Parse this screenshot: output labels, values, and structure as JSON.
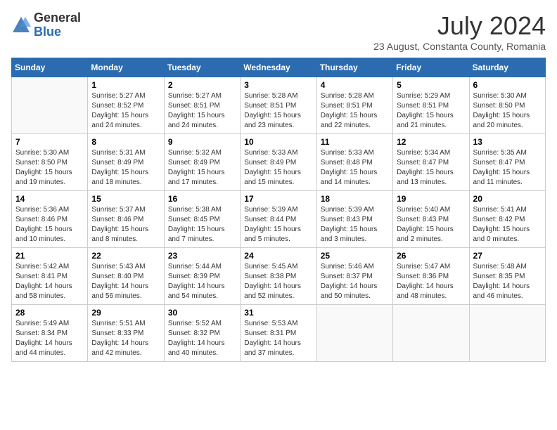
{
  "logo": {
    "general": "General",
    "blue": "Blue"
  },
  "title": "July 2024",
  "subtitle": "23 August, Constanta County, Romania",
  "days_of_week": [
    "Sunday",
    "Monday",
    "Tuesday",
    "Wednesday",
    "Thursday",
    "Friday",
    "Saturday"
  ],
  "weeks": [
    [
      {
        "day": "",
        "info": ""
      },
      {
        "day": "1",
        "info": "Sunrise: 5:27 AM\nSunset: 8:52 PM\nDaylight: 15 hours\nand 24 minutes."
      },
      {
        "day": "2",
        "info": "Sunrise: 5:27 AM\nSunset: 8:51 PM\nDaylight: 15 hours\nand 24 minutes."
      },
      {
        "day": "3",
        "info": "Sunrise: 5:28 AM\nSunset: 8:51 PM\nDaylight: 15 hours\nand 23 minutes."
      },
      {
        "day": "4",
        "info": "Sunrise: 5:28 AM\nSunset: 8:51 PM\nDaylight: 15 hours\nand 22 minutes."
      },
      {
        "day": "5",
        "info": "Sunrise: 5:29 AM\nSunset: 8:51 PM\nDaylight: 15 hours\nand 21 minutes."
      },
      {
        "day": "6",
        "info": "Sunrise: 5:30 AM\nSunset: 8:50 PM\nDaylight: 15 hours\nand 20 minutes."
      }
    ],
    [
      {
        "day": "7",
        "info": "Sunrise: 5:30 AM\nSunset: 8:50 PM\nDaylight: 15 hours\nand 19 minutes."
      },
      {
        "day": "8",
        "info": "Sunrise: 5:31 AM\nSunset: 8:49 PM\nDaylight: 15 hours\nand 18 minutes."
      },
      {
        "day": "9",
        "info": "Sunrise: 5:32 AM\nSunset: 8:49 PM\nDaylight: 15 hours\nand 17 minutes."
      },
      {
        "day": "10",
        "info": "Sunrise: 5:33 AM\nSunset: 8:49 PM\nDaylight: 15 hours\nand 15 minutes."
      },
      {
        "day": "11",
        "info": "Sunrise: 5:33 AM\nSunset: 8:48 PM\nDaylight: 15 hours\nand 14 minutes."
      },
      {
        "day": "12",
        "info": "Sunrise: 5:34 AM\nSunset: 8:47 PM\nDaylight: 15 hours\nand 13 minutes."
      },
      {
        "day": "13",
        "info": "Sunrise: 5:35 AM\nSunset: 8:47 PM\nDaylight: 15 hours\nand 11 minutes."
      }
    ],
    [
      {
        "day": "14",
        "info": "Sunrise: 5:36 AM\nSunset: 8:46 PM\nDaylight: 15 hours\nand 10 minutes."
      },
      {
        "day": "15",
        "info": "Sunrise: 5:37 AM\nSunset: 8:46 PM\nDaylight: 15 hours\nand 8 minutes."
      },
      {
        "day": "16",
        "info": "Sunrise: 5:38 AM\nSunset: 8:45 PM\nDaylight: 15 hours\nand 7 minutes."
      },
      {
        "day": "17",
        "info": "Sunrise: 5:39 AM\nSunset: 8:44 PM\nDaylight: 15 hours\nand 5 minutes."
      },
      {
        "day": "18",
        "info": "Sunrise: 5:39 AM\nSunset: 8:43 PM\nDaylight: 15 hours\nand 3 minutes."
      },
      {
        "day": "19",
        "info": "Sunrise: 5:40 AM\nSunset: 8:43 PM\nDaylight: 15 hours\nand 2 minutes."
      },
      {
        "day": "20",
        "info": "Sunrise: 5:41 AM\nSunset: 8:42 PM\nDaylight: 15 hours\nand 0 minutes."
      }
    ],
    [
      {
        "day": "21",
        "info": "Sunrise: 5:42 AM\nSunset: 8:41 PM\nDaylight: 14 hours\nand 58 minutes."
      },
      {
        "day": "22",
        "info": "Sunrise: 5:43 AM\nSunset: 8:40 PM\nDaylight: 14 hours\nand 56 minutes."
      },
      {
        "day": "23",
        "info": "Sunrise: 5:44 AM\nSunset: 8:39 PM\nDaylight: 14 hours\nand 54 minutes."
      },
      {
        "day": "24",
        "info": "Sunrise: 5:45 AM\nSunset: 8:38 PM\nDaylight: 14 hours\nand 52 minutes."
      },
      {
        "day": "25",
        "info": "Sunrise: 5:46 AM\nSunset: 8:37 PM\nDaylight: 14 hours\nand 50 minutes."
      },
      {
        "day": "26",
        "info": "Sunrise: 5:47 AM\nSunset: 8:36 PM\nDaylight: 14 hours\nand 48 minutes."
      },
      {
        "day": "27",
        "info": "Sunrise: 5:48 AM\nSunset: 8:35 PM\nDaylight: 14 hours\nand 46 minutes."
      }
    ],
    [
      {
        "day": "28",
        "info": "Sunrise: 5:49 AM\nSunset: 8:34 PM\nDaylight: 14 hours\nand 44 minutes."
      },
      {
        "day": "29",
        "info": "Sunrise: 5:51 AM\nSunset: 8:33 PM\nDaylight: 14 hours\nand 42 minutes."
      },
      {
        "day": "30",
        "info": "Sunrise: 5:52 AM\nSunset: 8:32 PM\nDaylight: 14 hours\nand 40 minutes."
      },
      {
        "day": "31",
        "info": "Sunrise: 5:53 AM\nSunset: 8:31 PM\nDaylight: 14 hours\nand 37 minutes."
      },
      {
        "day": "",
        "info": ""
      },
      {
        "day": "",
        "info": ""
      },
      {
        "day": "",
        "info": ""
      }
    ]
  ]
}
